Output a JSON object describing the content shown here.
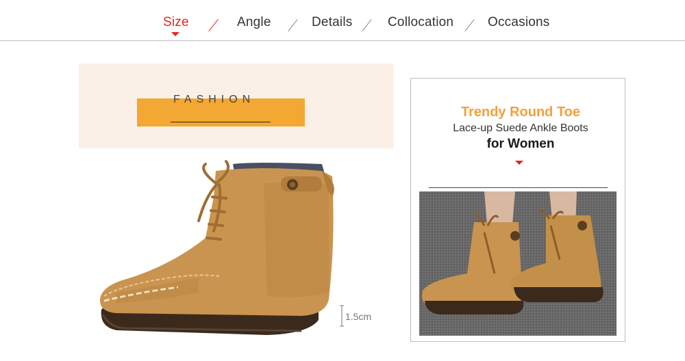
{
  "nav": {
    "items": [
      {
        "label": "Size",
        "active": true
      },
      {
        "label": "Angle",
        "active": false
      },
      {
        "label": "Details",
        "active": false
      },
      {
        "label": "Collocation",
        "active": false
      },
      {
        "label": "Occasions",
        "active": false
      }
    ]
  },
  "banner": {
    "text": "FASHION"
  },
  "measure": {
    "label": "1.5cm"
  },
  "product": {
    "title_line1": "Trendy Round Toe",
    "title_line2": "Lace-up Suede Ankle Boots",
    "title_line3": "for Women"
  },
  "colors": {
    "accent_red": "#e0251b",
    "accent_orange": "#f2a833",
    "banner_bg": "#fbf0e7",
    "suede": "#c9944f"
  }
}
